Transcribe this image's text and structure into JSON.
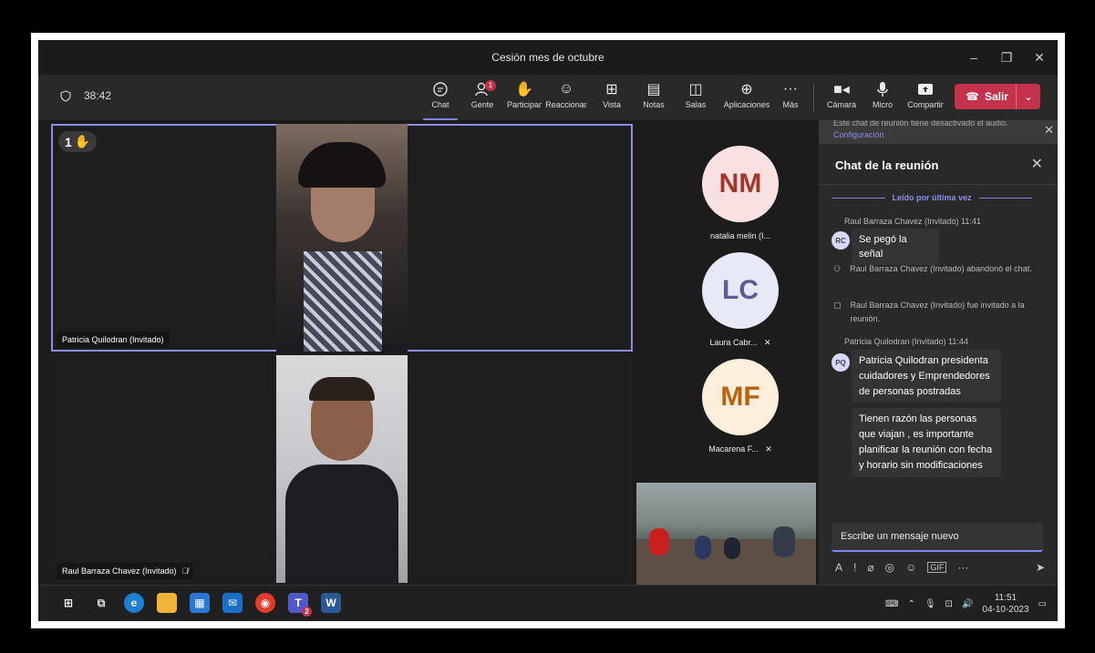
{
  "window": {
    "title": "Cesión mes de octubre"
  },
  "toolbar": {
    "timer": "38:42",
    "buttons": [
      {
        "label": "Chat",
        "icon": "chat-icon"
      },
      {
        "label": "Gente",
        "icon": "people-icon",
        "badge": "1"
      },
      {
        "label": "Participar",
        "icon": "raise-hand-icon"
      },
      {
        "label": "Reaccionar",
        "icon": "smile-icon"
      },
      {
        "label": "Vista",
        "icon": "grid-icon"
      },
      {
        "label": "Notas",
        "icon": "notes-icon"
      },
      {
        "label": "Salas",
        "icon": "rooms-icon"
      },
      {
        "label": "Aplicaciones",
        "icon": "apps-icon"
      },
      {
        "label": "Más",
        "icon": "more-icon"
      }
    ],
    "camera": "Cámara",
    "micro": "Micro",
    "share": "Compartir",
    "leave": "Salir"
  },
  "stage": {
    "tile1": {
      "name": "Patricia Quilodran (Invitado)",
      "hand_count": "1"
    },
    "tile2": {
      "name": "Raul Barraza Chavez (Invitado)"
    },
    "avatars": [
      {
        "initials": "NM",
        "name": "natalia melin (I..."
      },
      {
        "initials": "LC",
        "name": "Laura Cabr..."
      },
      {
        "initials": "MF",
        "name": "Macarena F..."
      }
    ]
  },
  "chat": {
    "banner": "Este chat de reunión tiene desactivado el audio.",
    "banner_link": "Configuración",
    "title": "Chat de la reunión",
    "last_read": "Leído por última vez",
    "msg1_meta": "Raul Barraza Chavez (Invitado)  11:41",
    "msg1_avatar": "RC",
    "msg1_text": "Se pegó la señal",
    "sys1": "Raul Barraza Chavez (Invitado) abandonó el chat.",
    "sys2": "Raul Barraza Chavez (Invitado) fue invitado a la reunión.",
    "msg2_meta": "Patricia Quilodran (Invitado)  11:44",
    "msg2_avatar": "PQ",
    "msg2_text": "Patricia Quilodran  presidenta cuidadores y Emprendedores de personas postradas",
    "msg3_text": "Tienen razón las personas que viajan , es importante planificar la reunión con fecha y horario sin modificaciones",
    "compose_placeholder": "Escribe un mensaje nuevo"
  },
  "taskbar": {
    "time": "11:51",
    "date": "04-10-2023",
    "teams_badge": "2"
  }
}
